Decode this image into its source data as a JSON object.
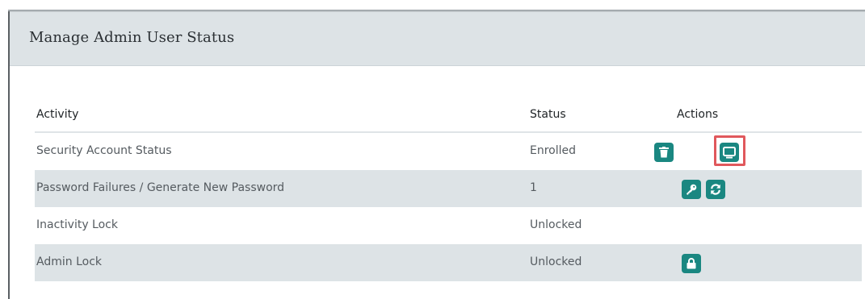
{
  "panel": {
    "title": "Manage Admin User Status"
  },
  "table": {
    "headers": {
      "activity": "Activity",
      "status": "Status",
      "actions": "Actions"
    },
    "rows": [
      {
        "activity": "Security Account Status",
        "status": "Enrolled",
        "actions": [
          "trash-icon",
          "monitor-icon"
        ]
      },
      {
        "activity": "Password Failures / Generate New Password",
        "status": "1",
        "actions": [
          "key-icon",
          "refresh-icon"
        ]
      },
      {
        "activity": "Inactivity Lock",
        "status": "Unlocked",
        "actions": []
      },
      {
        "activity": "Admin Lock",
        "status": "Unlocked",
        "actions": [
          "lock-icon"
        ]
      }
    ]
  },
  "colors": {
    "accent": "#1a8781",
    "highlight": "#e0585c",
    "header_bg": "#dde3e6",
    "row_shade": "#dde3e6"
  }
}
